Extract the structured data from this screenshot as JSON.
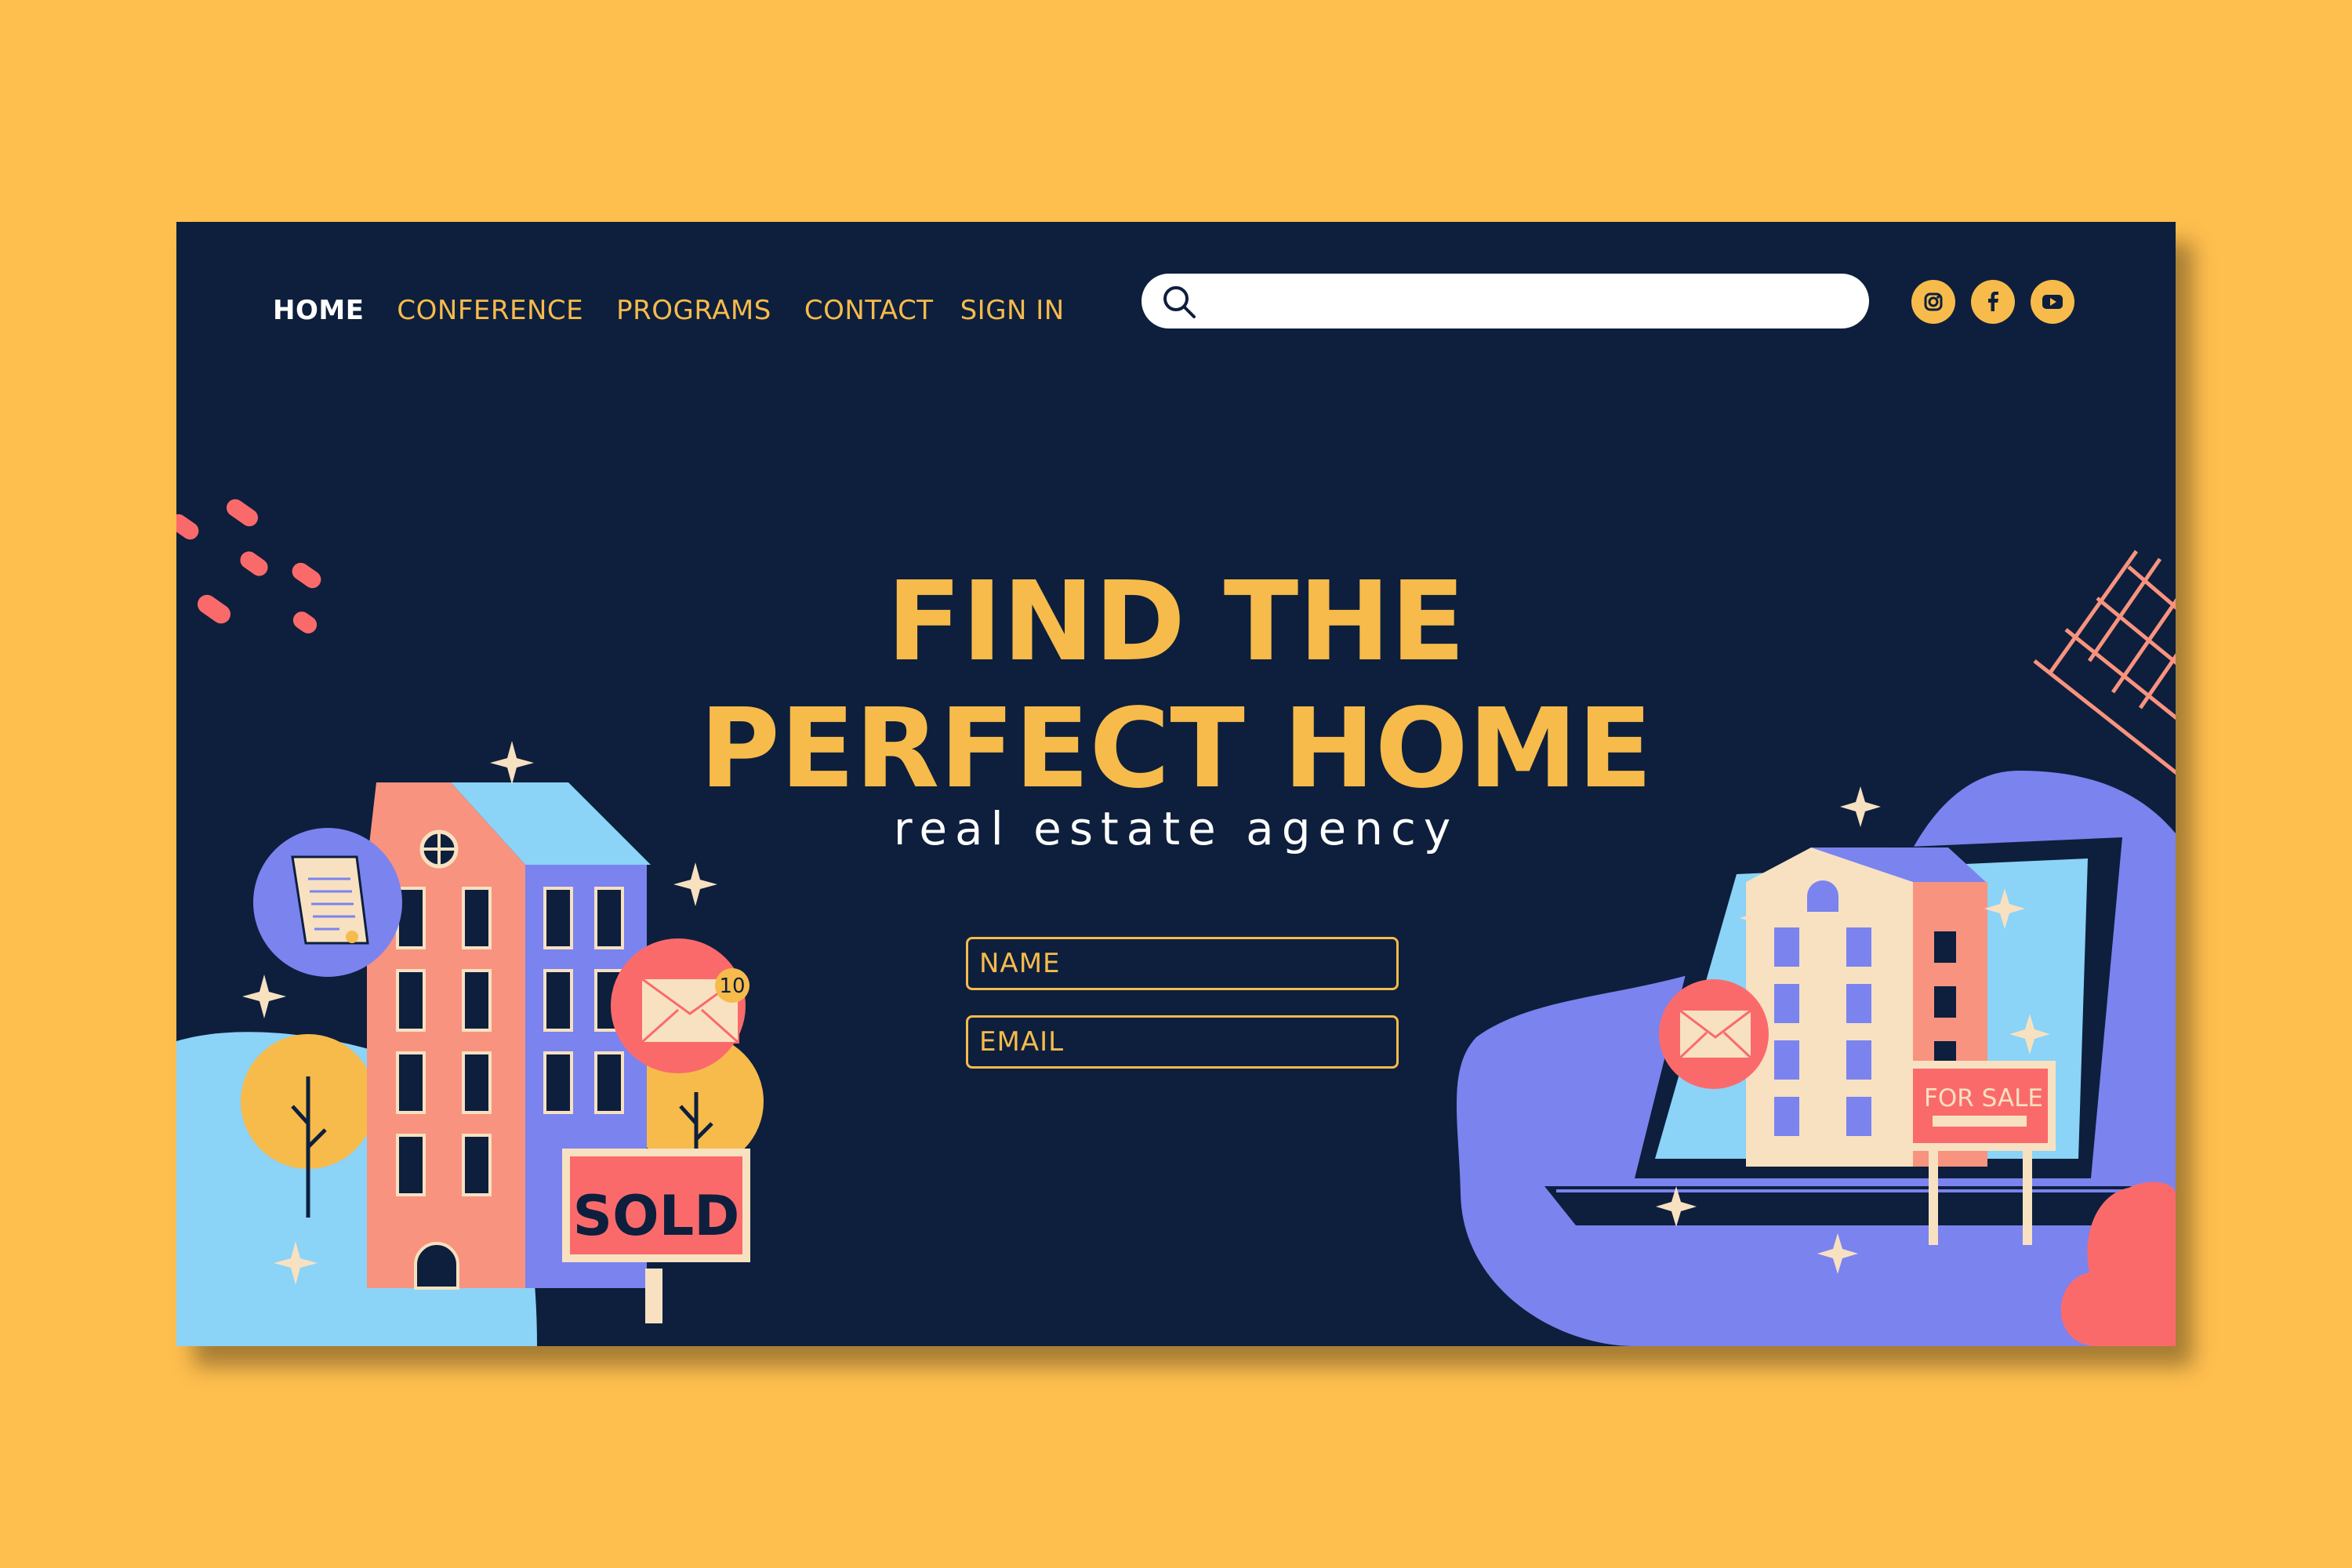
{
  "nav": {
    "items": [
      {
        "label": "HOME",
        "active": true
      },
      {
        "label": "CONFERENCE",
        "active": false
      },
      {
        "label": "PROGRAMS",
        "active": false
      },
      {
        "label": "CONTACT",
        "active": false
      },
      {
        "label": "SIGN IN",
        "active": false
      }
    ]
  },
  "search": {
    "placeholder": "",
    "value": ""
  },
  "social": [
    "instagram-icon",
    "facebook-icon",
    "youtube-icon"
  ],
  "hero": {
    "title_line1": "FIND THE",
    "title_line2": "PERFECT HOME",
    "subtitle": "real estate agency"
  },
  "form": {
    "name_placeholder": "NAME",
    "email_placeholder": "EMAIL"
  },
  "illustration": {
    "sold_sign": "SOLD",
    "sale_sign": "FOR SALE",
    "mail_badge": "10"
  },
  "colors": {
    "background": "#ffbf4f",
    "panel": "#0d1f3c",
    "accent": "#f7bb4b",
    "salmon": "#f8937f",
    "periwinkle": "#7b83ef",
    "sky": "#8bd3f7",
    "coral": "#fb6a6b"
  }
}
